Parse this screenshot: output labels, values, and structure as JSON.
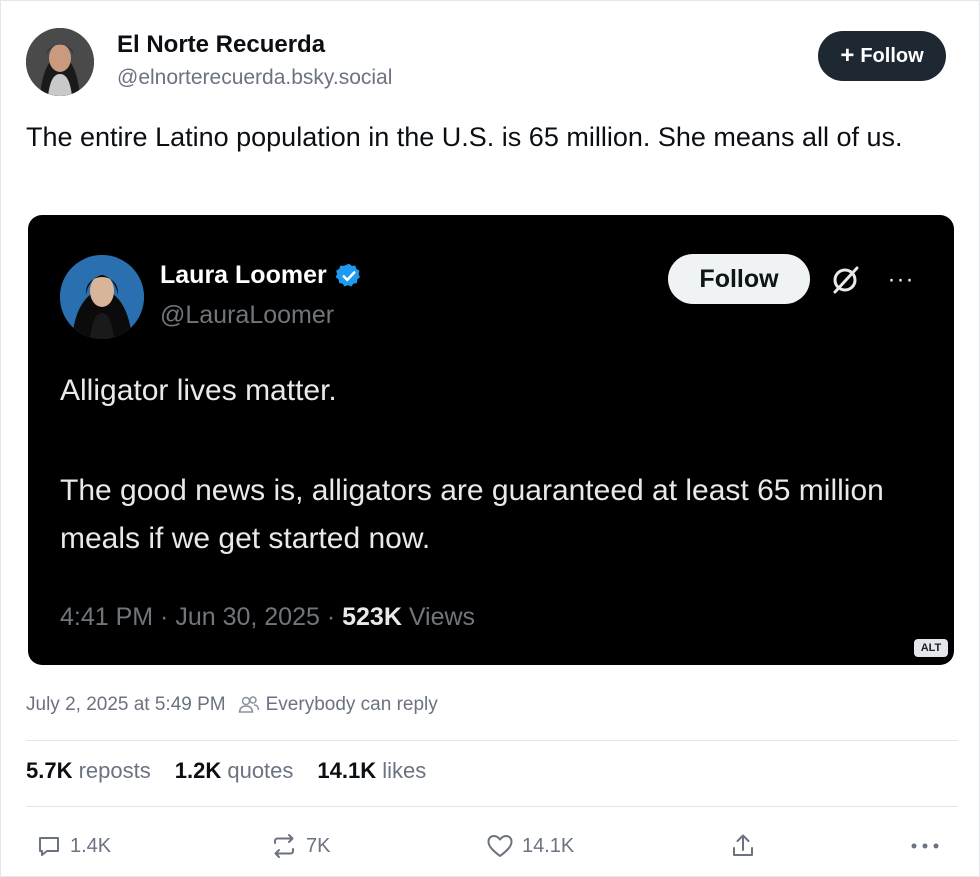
{
  "author": {
    "display_name": "El Norte Recuerda",
    "handle": "@elnorterecuerda.bsky.social",
    "follow_label": "Follow"
  },
  "post": {
    "text": "The entire Latino population in the U.S. is 65 million. She means all of us."
  },
  "embed": {
    "display_name": "Laura Loomer",
    "handle": "@LauraLoomer",
    "follow_label": "Follow",
    "text_line1": "Alligator lives matter.",
    "text_line2": "The good news is, alligators are guaranteed at least 65 million meals if we get started now.",
    "meta_time": "4:41 PM · Jun 30, 2025 · ",
    "views_count": "523K",
    "views_label": " Views",
    "alt_badge": "ALT",
    "verified_color": "#1d9bf0"
  },
  "details": {
    "timestamp": "July 2, 2025 at 5:49 PM",
    "reply_setting": "Everybody can reply"
  },
  "stats": {
    "reposts_count": "5.7K",
    "reposts_label": " reposts",
    "quotes_count": "1.2K",
    "quotes_label": " quotes",
    "likes_count": "14.1K",
    "likes_label": " likes"
  },
  "actions": {
    "reply_count": "1.4K",
    "repost_count": "7K",
    "like_count": "14.1K"
  }
}
